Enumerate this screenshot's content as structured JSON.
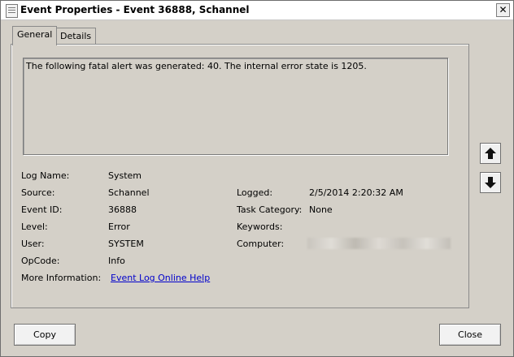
{
  "window": {
    "title": "Event Properties - Event 36888, Schannel"
  },
  "tabs": [
    {
      "label": "General"
    },
    {
      "label": "Details"
    }
  ],
  "message": "The following fatal alert was generated: 40. The internal error state is 1205.",
  "fields": {
    "log_name_label": "Log Name:",
    "log_name": "System",
    "source_label": "Source:",
    "source": "Schannel",
    "event_id_label": "Event ID:",
    "event_id": "36888",
    "level_label": "Level:",
    "level": "Error",
    "user_label": "User:",
    "user": "SYSTEM",
    "opcode_label": "OpCode:",
    "opcode": "Info",
    "more_info_label": "More Information:",
    "more_info_link": "Event Log Online Help",
    "logged_label": "Logged:",
    "logged": "2/5/2014 2:20:32 AM",
    "task_category_label": "Task Category:",
    "task_category": "None",
    "keywords_label": "Keywords:",
    "keywords": "",
    "computer_label": "Computer:"
  },
  "buttons": {
    "copy": "Copy",
    "close": "Close"
  },
  "icons": {
    "close": "close-icon",
    "previous": "arrow-up-icon",
    "next": "arrow-down-icon"
  }
}
